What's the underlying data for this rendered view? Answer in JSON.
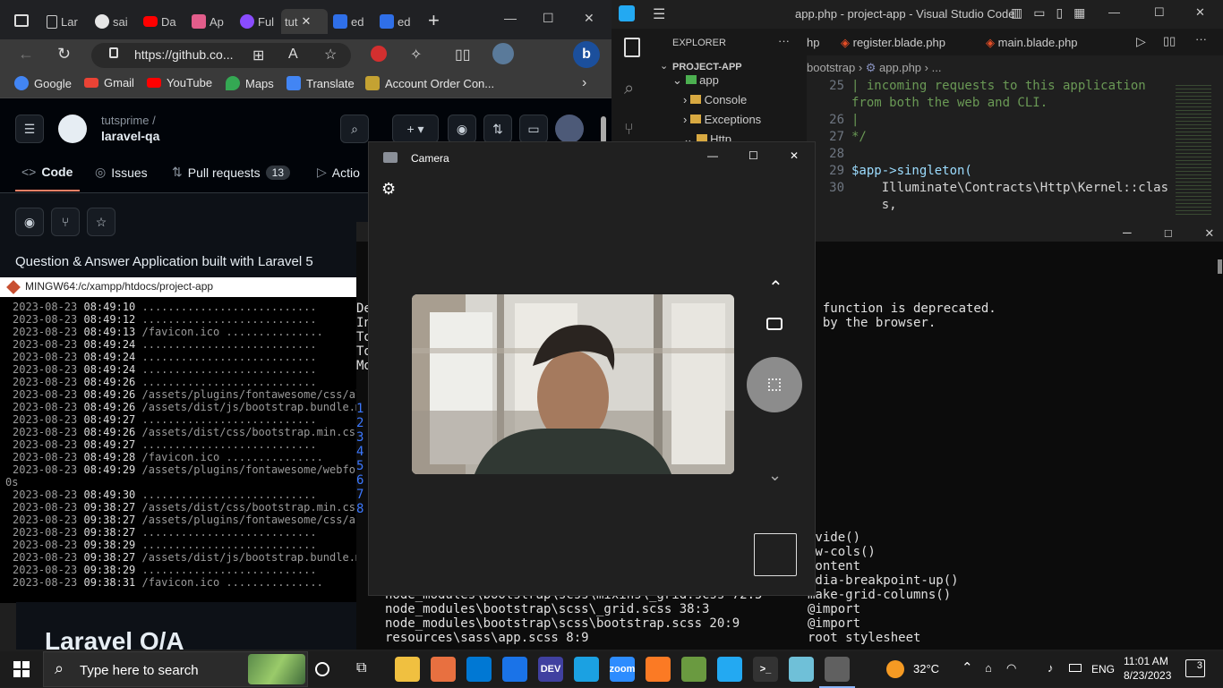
{
  "browser": {
    "tabs": [
      {
        "label": "Lar",
        "color": "#6e7681"
      },
      {
        "label": "sai",
        "color": "#e6e6e6"
      },
      {
        "label": "Da",
        "color": "#ff0000"
      },
      {
        "label": "Ap",
        "color": "#e25d8b"
      },
      {
        "label": "Ful",
        "color": "#8a4cff"
      },
      {
        "label": "tut",
        "color": "#dddddd"
      },
      {
        "label": "ed",
        "color": "#2f6fe8"
      },
      {
        "label": "ed",
        "color": "#2f6fe8"
      }
    ],
    "url": "https://github.co...",
    "favorites": [
      {
        "label": "Google",
        "color": "#4285f4"
      },
      {
        "label": "Gmail",
        "color": "#ea4335"
      },
      {
        "label": "YouTube",
        "color": "#ff0000"
      },
      {
        "label": "Maps",
        "color": "#34a853"
      },
      {
        "label": "Translate",
        "color": "#4285f4"
      },
      {
        "label": "Account Order Con...",
        "color": "#c4a232"
      }
    ],
    "github": {
      "owner": "tutsprime /",
      "repo": "laravel-qa",
      "tabs": {
        "code": "Code",
        "issues": "Issues",
        "pulls": "Pull requests",
        "pulls_count": "13",
        "actions": "Actio"
      },
      "description": "Question & Answer Application built with Laravel 5",
      "page_heading": "Laravel Q/A"
    }
  },
  "gitbash": {
    "title": "MINGW64:/c/xampp/htdocs/project-app",
    "lines": [
      {
        "date": "2023-08-23",
        "time": "08:49:10",
        "text": " ..........................."
      },
      {
        "date": "2023-08-23",
        "time": "08:49:12",
        "text": " ..........................."
      },
      {
        "date": "2023-08-23",
        "time": "08:49:13",
        "text": " /favicon.ico ..............."
      },
      {
        "date": "2023-08-23",
        "time": "08:49:24",
        "text": " ..........................."
      },
      {
        "date": "2023-08-23",
        "time": "08:49:24",
        "text": " ..........................."
      },
      {
        "date": "2023-08-23",
        "time": "08:49:24",
        "text": " ..........................."
      },
      {
        "date": "2023-08-23",
        "time": "08:49:26",
        "text": " ..........................."
      },
      {
        "date": "2023-08-23",
        "time": "08:49:26",
        "text": " /assets/plugins/fontawesome/css/all"
      },
      {
        "date": "2023-08-23",
        "time": "08:49:26",
        "text": " /assets/dist/js/bootstrap.bundle.mi"
      },
      {
        "date": "2023-08-23",
        "time": "08:49:27",
        "text": " ..........................."
      },
      {
        "date": "2023-08-23",
        "time": "08:49:26",
        "text": " /assets/dist/css/bootstrap.min.css "
      },
      {
        "date": "2023-08-23",
        "time": "08:49:27",
        "text": " ..........................."
      },
      {
        "date": "2023-08-23",
        "time": "08:49:28",
        "text": " /favicon.ico ..............."
      },
      {
        "date": "2023-08-23",
        "time": "08:49:29",
        "text": " /assets/plugins/fontawesome/webfont"
      },
      {
        "date": "0s",
        "time": "",
        "text": ""
      },
      {
        "date": "2023-08-23",
        "time": "08:49:30",
        "text": " ..........................."
      },
      {
        "date": "2023-08-23",
        "time": "09:38:27",
        "text": " /assets/dist/css/bootstrap.min.css "
      },
      {
        "date": "2023-08-23",
        "time": "09:38:27",
        "text": " /assets/plugins/fontawesome/css/all"
      },
      {
        "date": "2023-08-23",
        "time": "09:38:27",
        "text": " ..........................."
      },
      {
        "date": "2023-08-23",
        "time": "09:38:29",
        "text": " ..........................."
      },
      {
        "date": "2023-08-23",
        "time": "09:38:27",
        "text": " /assets/dist/js/bootstrap.bundle.mi"
      },
      {
        "date": "2023-08-23",
        "time": "09:38:29",
        "text": " ..........................."
      },
      {
        "date": "2023-08-23",
        "time": "09:38:31",
        "text": " /favicon.ico ..............."
      }
    ]
  },
  "vscode": {
    "title": "app.php - project-app - Visual Studio Code",
    "explorer_title": "EXPLORER",
    "project": "PROJECT-APP",
    "tree": [
      "app",
      "Console",
      "Exceptions",
      "Http"
    ],
    "tabs": [
      "hp",
      "register.blade.php",
      "main.blade.php"
    ],
    "breadcrumb": [
      "bootstrap",
      "app.php",
      "..."
    ],
    "code": [
      {
        "n": "25",
        "text": "| incoming requests to this application"
      },
      {
        "n": "",
        "text": "from both the web and CLI."
      },
      {
        "n": "26",
        "text": "|"
      },
      {
        "n": "27",
        "text": "*/"
      },
      {
        "n": "28",
        "text": ""
      },
      {
        "n": "29",
        "text": "$app->singleton("
      },
      {
        "n": "30",
        "text": "    Illuminate\\Contracts\\Http\\Kernel::clas"
      },
      {
        "n": "",
        "text": "    s,"
      }
    ]
  },
  "terminal_right": {
    "left_fragments": [
      "De",
      "In",
      "To",
      "To",
      "Mo"
    ],
    "numbers": [
      "1",
      "2",
      "3",
      "4",
      "5",
      "6",
      "7",
      "8"
    ],
    "messages": [
      ") function is deprecated.",
      "d by the browser."
    ],
    "stack_left": [
      "node_modules\\bootstrap\\scss\\mixins\\_grid.scss 72:5",
      "node_modules\\bootstrap\\scss\\_grid.scss 38:3",
      "node_modules\\bootstrap\\scss\\bootstrap.scss 20:9",
      "resources\\sass\\app.scss 8:9"
    ],
    "stack_right": [
      "ivide()",
      "ow-cols()",
      "content",
      "edia-breakpoint-up()",
      "make-grid-columns()",
      "@import",
      "@import",
      "root stylesheet"
    ]
  },
  "camera": {
    "title": "Camera"
  },
  "taskbar": {
    "search_placeholder": "Type here to search",
    "temperature": "32°C",
    "language": "ENG",
    "time": "11:01 AM",
    "date": "8/23/2023",
    "notifications": "3",
    "apps": [
      {
        "name": "file-explorer",
        "color": "#f0c040",
        "label": ""
      },
      {
        "name": "paint",
        "color": "#e87040",
        "label": ""
      },
      {
        "name": "store",
        "color": "#0078d4",
        "label": ""
      },
      {
        "name": "mail",
        "color": "#1a73e8",
        "label": ""
      },
      {
        "name": "devcpp",
        "color": "#4040a0",
        "label": "DEV"
      },
      {
        "name": "edge",
        "color": "#1ba1e2",
        "label": ""
      },
      {
        "name": "zoom",
        "color": "#2d8cff",
        "label": "zoom"
      },
      {
        "name": "xampp",
        "color": "#fb7a24",
        "label": ""
      },
      {
        "name": "sourcetree",
        "color": "#6a9a40",
        "label": ""
      },
      {
        "name": "vscode",
        "color": "#23a9f2",
        "label": ""
      },
      {
        "name": "terminal",
        "color": "#333333",
        "label": ">_"
      },
      {
        "name": "notepad",
        "color": "#6fc0d8",
        "label": ""
      },
      {
        "name": "camera",
        "color": "#606060",
        "label": ""
      }
    ]
  }
}
